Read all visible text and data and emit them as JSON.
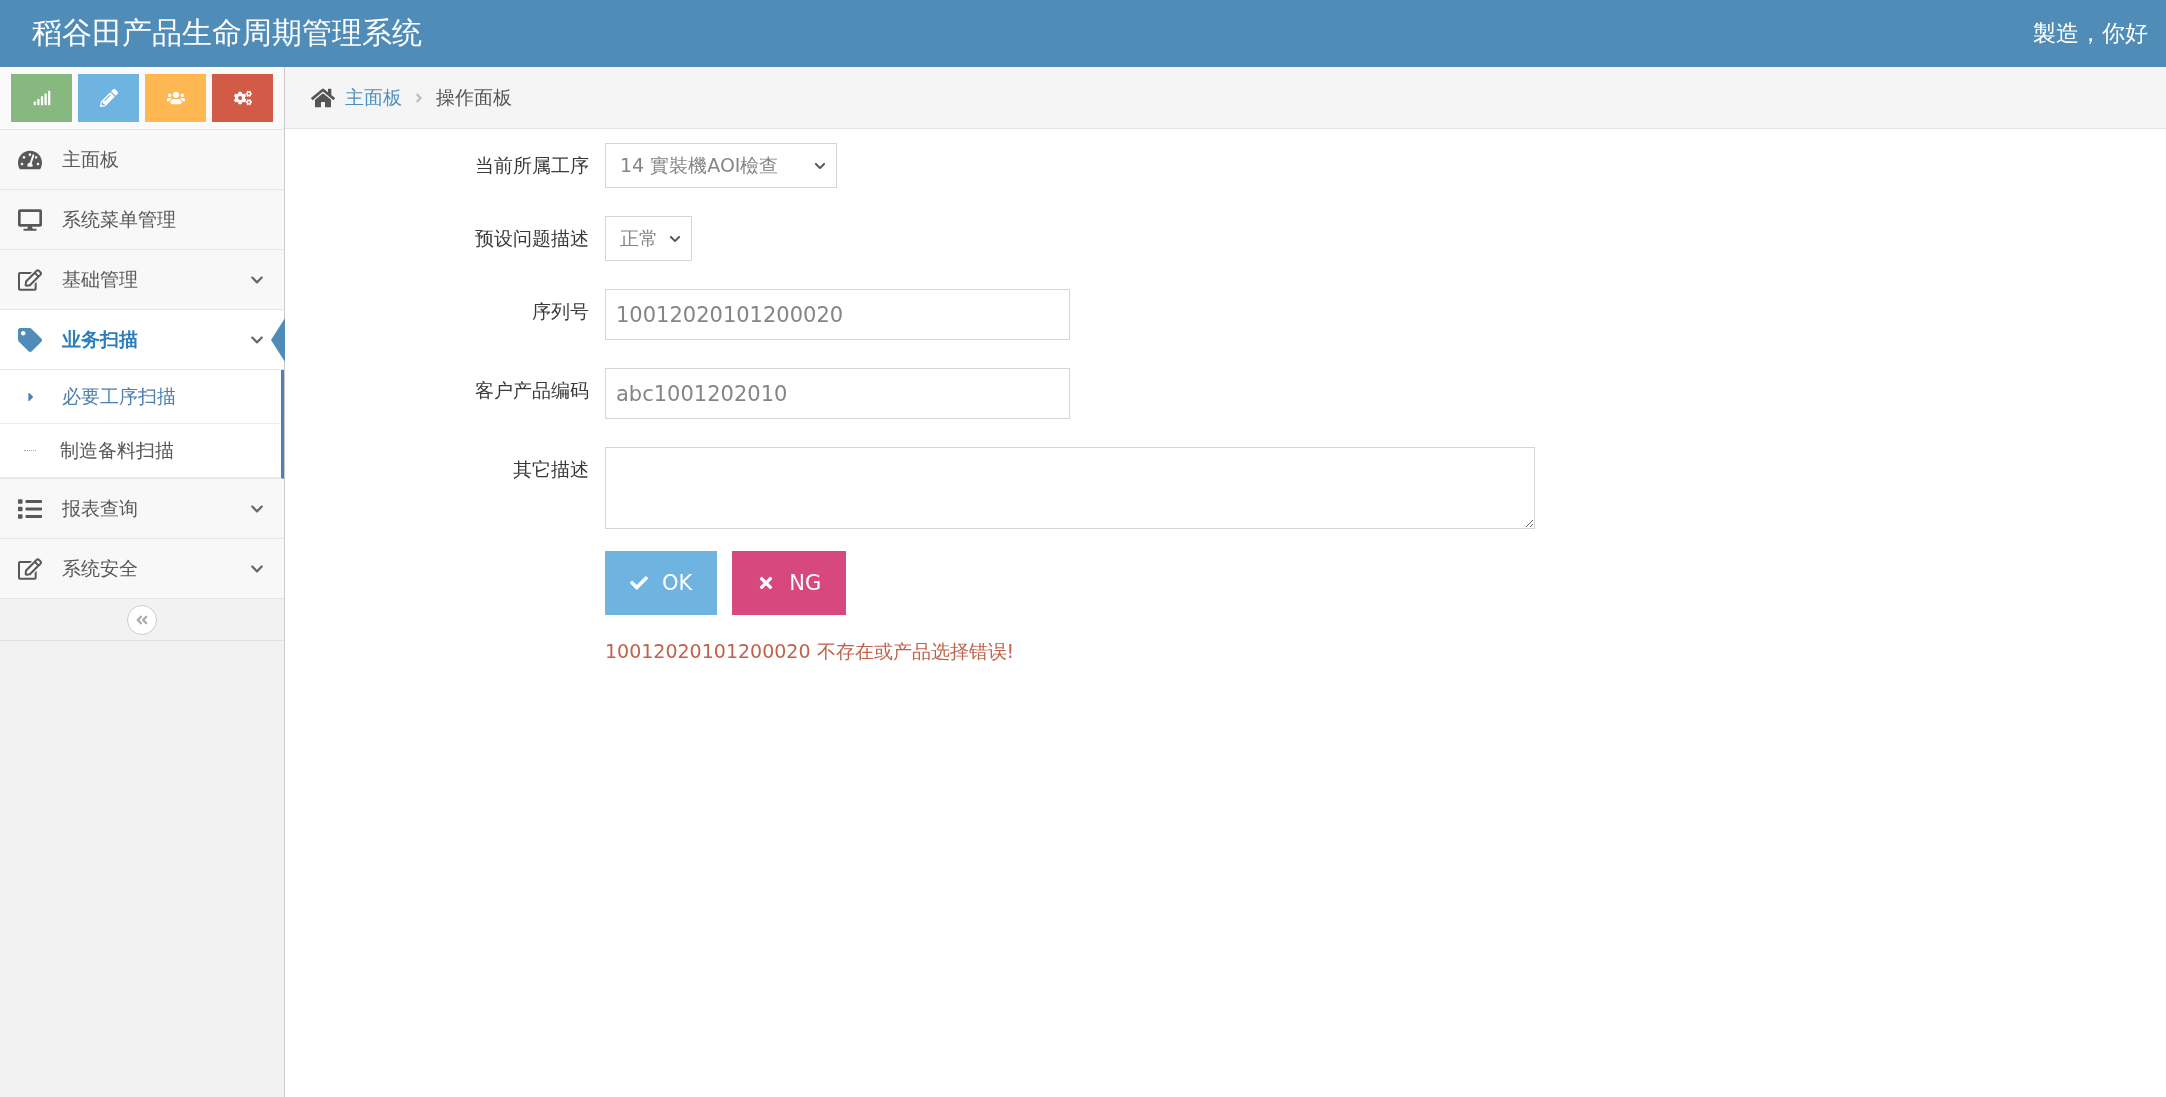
{
  "header": {
    "title": "稻谷田产品生命周期管理系统",
    "greeting": "製造，你好"
  },
  "shortcuts": [
    {
      "color": "#87b87f"
    },
    {
      "color": "#6fb3e0"
    },
    {
      "color": "#ffb752"
    },
    {
      "color": "#d15b47"
    }
  ],
  "sidebar": {
    "items": [
      {
        "label": "主面板",
        "selected": false,
        "expandable": false
      },
      {
        "label": "系统菜单管理",
        "selected": false,
        "expandable": false
      },
      {
        "label": "基础管理",
        "selected": false,
        "expandable": true
      },
      {
        "label": "业务扫描",
        "selected": true,
        "expandable": true,
        "children": [
          {
            "label": "必要工序扫描",
            "selected": true
          },
          {
            "label": "制造备料扫描",
            "selected": false
          }
        ]
      },
      {
        "label": "报表查询",
        "selected": false,
        "expandable": true
      },
      {
        "label": "系统安全",
        "selected": false,
        "expandable": true
      }
    ]
  },
  "breadcrumb": [
    {
      "label": "主面板",
      "link": true
    },
    {
      "label": "操作面板",
      "link": false
    }
  ],
  "form": {
    "fields": [
      {
        "kind": "select",
        "label": "当前所属工序",
        "value": "14 實裝機AOI檢查"
      },
      {
        "kind": "select",
        "label": "预设问题描述",
        "value": "正常"
      },
      {
        "kind": "input",
        "label": "序列号",
        "value": "10012020101200020"
      },
      {
        "kind": "input",
        "label": "客户产品编码",
        "value": "abc1001202010"
      },
      {
        "kind": "textarea",
        "label": "其它描述"
      }
    ],
    "buttons": [
      {
        "label": "OK",
        "kind": "ok"
      },
      {
        "label": "NG",
        "kind": "ng"
      }
    ],
    "message": "10012020101200020 不存在或产品选择错误!"
  }
}
